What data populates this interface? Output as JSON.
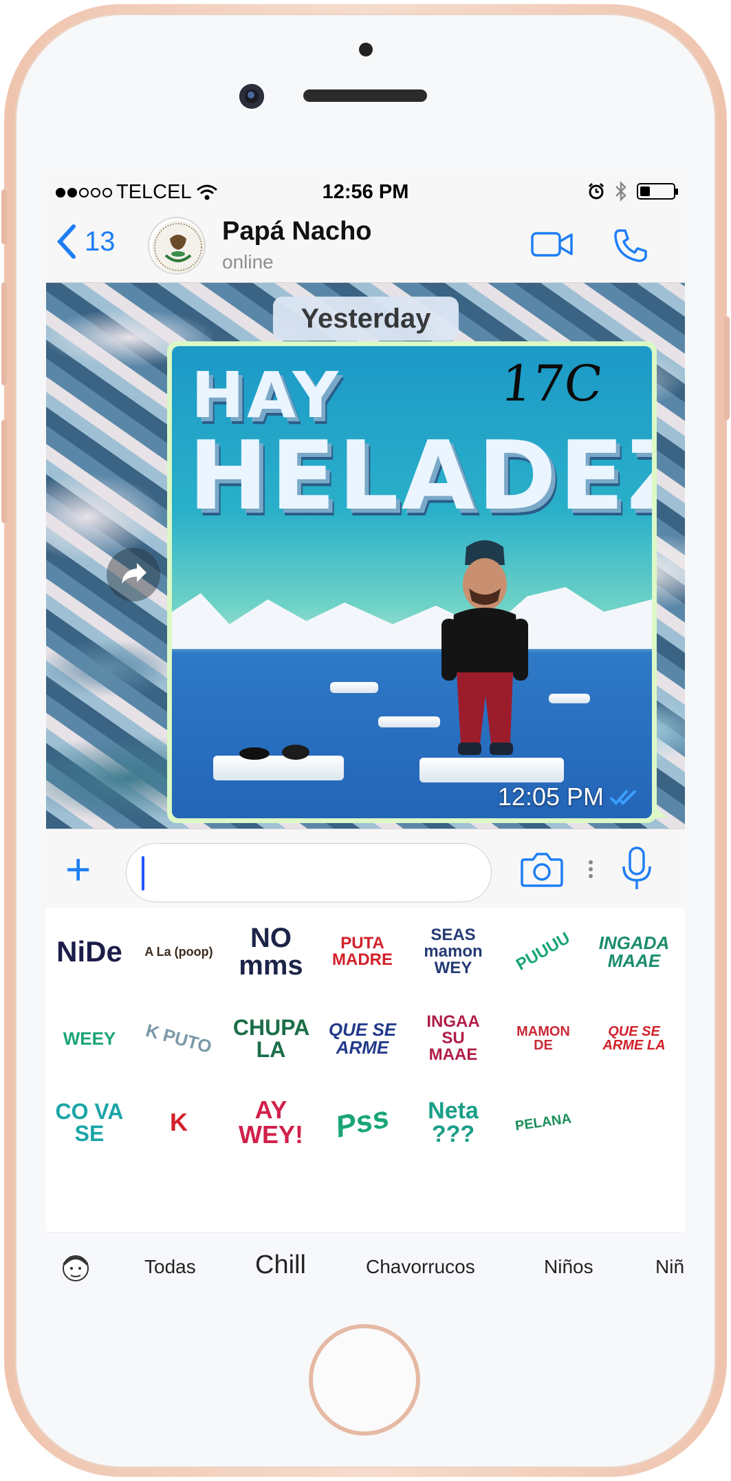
{
  "statusbar": {
    "carrier": "TELCEL",
    "time": "12:56 PM"
  },
  "nav": {
    "back_count": "13",
    "contact_name": "Papá Nacho",
    "contact_status": "online"
  },
  "chat": {
    "date_label": "Yesterday",
    "message": {
      "image_line1": "HAY",
      "image_line2": "HELADEZ",
      "image_temp": "17C",
      "time": "12:05 PM",
      "status": "read"
    }
  },
  "stickers": [
    [
      "NiDe",
      "A La (poop)",
      "NO mms",
      "PUTA MADRE",
      "SEAS mamon WEY",
      "PUUUU",
      "INGADA MAAE"
    ],
    [
      "WEEY",
      "K PUTO",
      "CHUPA LA",
      "QUE SE ARME",
      "INGAA SU MAAE",
      "MAMON DE",
      "QUE SE ARME LA"
    ],
    [
      "CO VA SE",
      "K",
      "AY WEY!",
      "Pss",
      "Neta ???",
      "PELANA"
    ]
  ],
  "tabs": [
    "Todas",
    "Chill",
    "Chavorrucos",
    "Niños",
    "Niñ"
  ],
  "colors": {
    "accent": "#1e7ef5",
    "bubble": "#dcf8c6",
    "phone": "#efc4ae"
  }
}
